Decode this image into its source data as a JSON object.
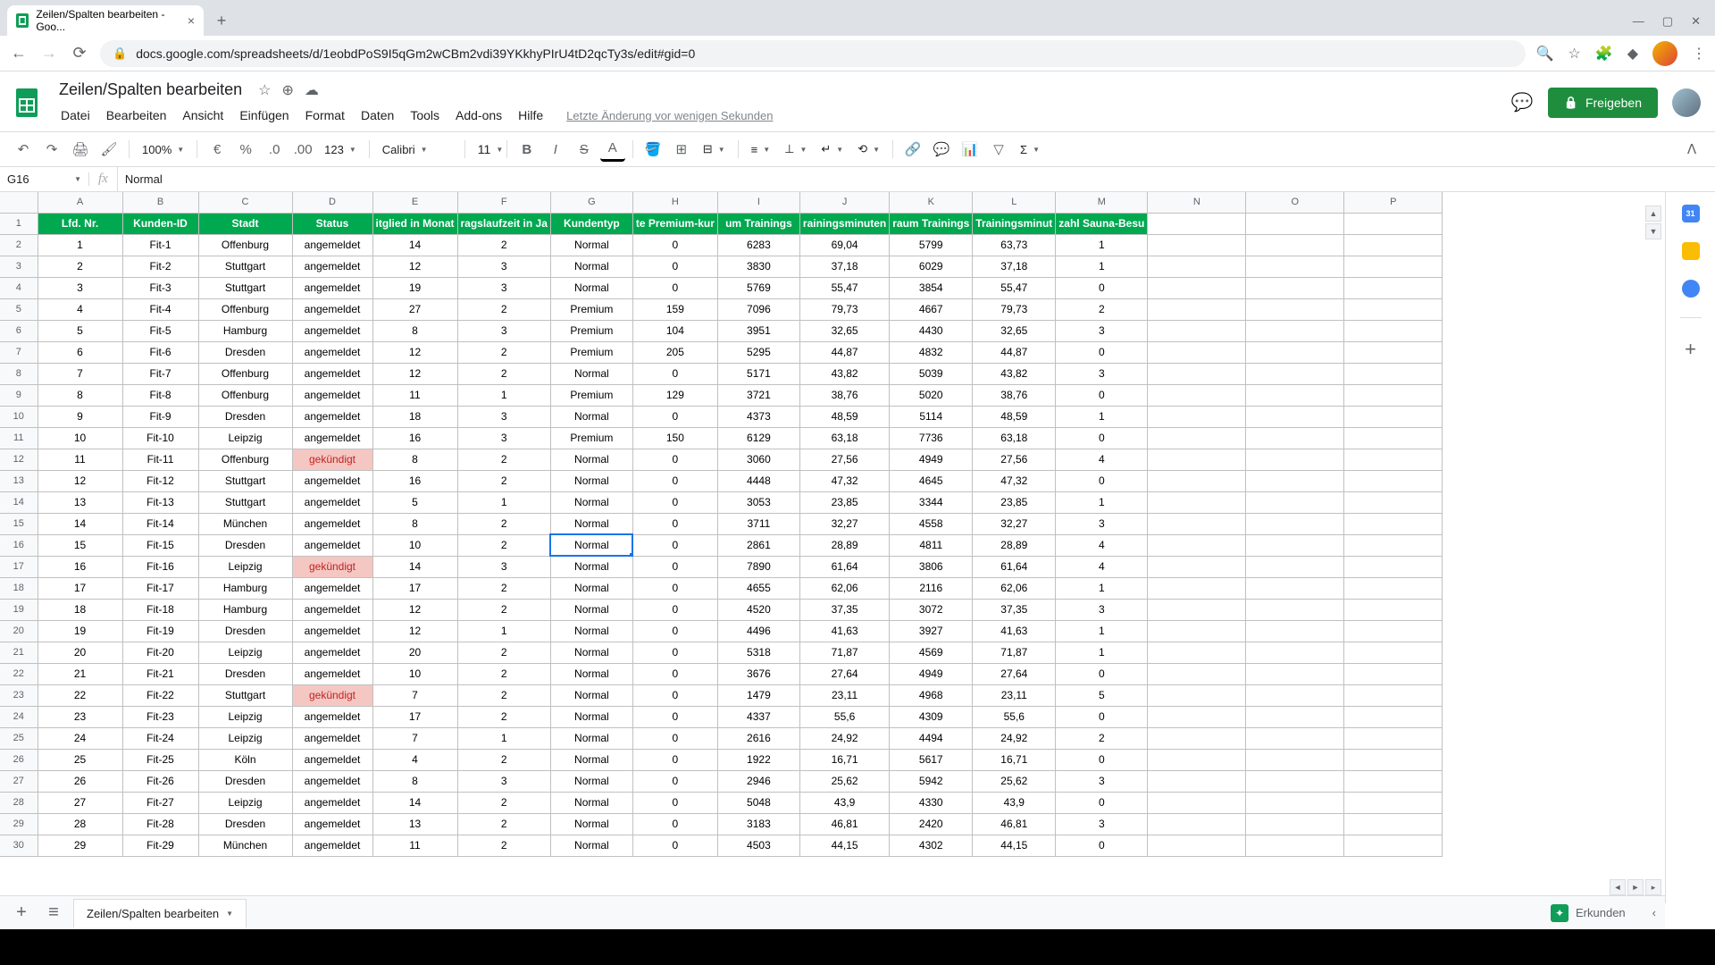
{
  "browser": {
    "tab_title": "Zeilen/Spalten bearbeiten - Goo...",
    "url": "docs.google.com/spreadsheets/d/1eobdPoS9I5qGm2wCBm2vdi39YKkhyPIrU4tD2qcTy3s/edit#gid=0"
  },
  "doc": {
    "title": "Zeilen/Spalten bearbeiten",
    "last_edit": "Letzte Änderung vor wenigen Sekunden"
  },
  "menu": [
    "Datei",
    "Bearbeiten",
    "Ansicht",
    "Einfügen",
    "Format",
    "Daten",
    "Tools",
    "Add-ons",
    "Hilfe"
  ],
  "toolbar": {
    "zoom": "100%",
    "font": "Calibri",
    "font_size": "11",
    "num_fmt": "123"
  },
  "share_label": "Freigeben",
  "name_box": "G16",
  "formula": "Normal",
  "sheet_tab": "Zeilen/Spalten bearbeiten",
  "explore_label": "Erkunden",
  "col_letters": [
    "A",
    "B",
    "C",
    "D",
    "E",
    "F",
    "G",
    "H",
    "I",
    "J",
    "K",
    "L",
    "M",
    "N",
    "O",
    "P"
  ],
  "headers": [
    "Lfd. Nr.",
    "Kunden-ID",
    "Stadt",
    "Status",
    "itglied in Monat",
    "ragslaufzeit in Ja",
    "Kundentyp",
    "te Premium-kur",
    "um Trainings",
    "rainingsminuten",
    "raum Trainings",
    "Trainingsminut",
    "zahl Sauna-Besu"
  ],
  "rows": [
    [
      1,
      "Fit-1",
      "Offenburg",
      "angemeldet",
      14,
      2,
      "Normal",
      0,
      6283,
      "69,04",
      5799,
      "63,73",
      1
    ],
    [
      2,
      "Fit-2",
      "Stuttgart",
      "angemeldet",
      12,
      3,
      "Normal",
      0,
      3830,
      "37,18",
      6029,
      "37,18",
      1
    ],
    [
      3,
      "Fit-3",
      "Stuttgart",
      "angemeldet",
      19,
      3,
      "Normal",
      0,
      5769,
      "55,47",
      3854,
      "55,47",
      0
    ],
    [
      4,
      "Fit-4",
      "Offenburg",
      "angemeldet",
      27,
      2,
      "Premium",
      159,
      7096,
      "79,73",
      4667,
      "79,73",
      2
    ],
    [
      5,
      "Fit-5",
      "Hamburg",
      "angemeldet",
      8,
      3,
      "Premium",
      104,
      3951,
      "32,65",
      4430,
      "32,65",
      3
    ],
    [
      6,
      "Fit-6",
      "Dresden",
      "angemeldet",
      12,
      2,
      "Premium",
      205,
      5295,
      "44,87",
      4832,
      "44,87",
      0
    ],
    [
      7,
      "Fit-7",
      "Offenburg",
      "angemeldet",
      12,
      2,
      "Normal",
      0,
      5171,
      "43,82",
      5039,
      "43,82",
      3
    ],
    [
      8,
      "Fit-8",
      "Offenburg",
      "angemeldet",
      11,
      1,
      "Premium",
      129,
      3721,
      "38,76",
      5020,
      "38,76",
      0
    ],
    [
      9,
      "Fit-9",
      "Dresden",
      "angemeldet",
      18,
      3,
      "Normal",
      0,
      4373,
      "48,59",
      5114,
      "48,59",
      1
    ],
    [
      10,
      "Fit-10",
      "Leipzig",
      "angemeldet",
      16,
      3,
      "Premium",
      150,
      6129,
      "63,18",
      7736,
      "63,18",
      0
    ],
    [
      11,
      "Fit-11",
      "Offenburg",
      "gekündigt",
      8,
      2,
      "Normal",
      0,
      3060,
      "27,56",
      4949,
      "27,56",
      4
    ],
    [
      12,
      "Fit-12",
      "Stuttgart",
      "angemeldet",
      16,
      2,
      "Normal",
      0,
      4448,
      "47,32",
      4645,
      "47,32",
      0
    ],
    [
      13,
      "Fit-13",
      "Stuttgart",
      "angemeldet",
      5,
      1,
      "Normal",
      0,
      3053,
      "23,85",
      3344,
      "23,85",
      1
    ],
    [
      14,
      "Fit-14",
      "München",
      "angemeldet",
      8,
      2,
      "Normal",
      0,
      3711,
      "32,27",
      4558,
      "32,27",
      3
    ],
    [
      15,
      "Fit-15",
      "Dresden",
      "angemeldet",
      10,
      2,
      "Normal",
      0,
      2861,
      "28,89",
      4811,
      "28,89",
      4
    ],
    [
      16,
      "Fit-16",
      "Leipzig",
      "gekündigt",
      14,
      3,
      "Normal",
      0,
      7890,
      "61,64",
      3806,
      "61,64",
      4
    ],
    [
      17,
      "Fit-17",
      "Hamburg",
      "angemeldet",
      17,
      2,
      "Normal",
      0,
      4655,
      "62,06",
      2116,
      "62,06",
      1
    ],
    [
      18,
      "Fit-18",
      "Hamburg",
      "angemeldet",
      12,
      2,
      "Normal",
      0,
      4520,
      "37,35",
      3072,
      "37,35",
      3
    ],
    [
      19,
      "Fit-19",
      "Dresden",
      "angemeldet",
      12,
      1,
      "Normal",
      0,
      4496,
      "41,63",
      3927,
      "41,63",
      1
    ],
    [
      20,
      "Fit-20",
      "Leipzig",
      "angemeldet",
      20,
      2,
      "Normal",
      0,
      5318,
      "71,87",
      4569,
      "71,87",
      1
    ],
    [
      21,
      "Fit-21",
      "Dresden",
      "angemeldet",
      10,
      2,
      "Normal",
      0,
      3676,
      "27,64",
      4949,
      "27,64",
      0
    ],
    [
      22,
      "Fit-22",
      "Stuttgart",
      "gekündigt",
      7,
      2,
      "Normal",
      0,
      1479,
      "23,11",
      4968,
      "23,11",
      5
    ],
    [
      23,
      "Fit-23",
      "Leipzig",
      "angemeldet",
      17,
      2,
      "Normal",
      0,
      4337,
      "55,6",
      4309,
      "55,6",
      0
    ],
    [
      24,
      "Fit-24",
      "Leipzig",
      "angemeldet",
      7,
      1,
      "Normal",
      0,
      2616,
      "24,92",
      4494,
      "24,92",
      2
    ],
    [
      25,
      "Fit-25",
      "Köln",
      "angemeldet",
      4,
      2,
      "Normal",
      0,
      1922,
      "16,71",
      5617,
      "16,71",
      0
    ],
    [
      26,
      "Fit-26",
      "Dresden",
      "angemeldet",
      8,
      3,
      "Normal",
      0,
      2946,
      "25,62",
      5942,
      "25,62",
      3
    ],
    [
      27,
      "Fit-27",
      "Leipzig",
      "angemeldet",
      14,
      2,
      "Normal",
      0,
      5048,
      "43,9",
      4330,
      "43,9",
      0
    ],
    [
      28,
      "Fit-28",
      "Dresden",
      "angemeldet",
      13,
      2,
      "Normal",
      0,
      3183,
      "46,81",
      2420,
      "46,81",
      3
    ],
    [
      29,
      "Fit-29",
      "München",
      "angemeldet",
      11,
      2,
      "Normal",
      0,
      4503,
      "44,15",
      4302,
      "44,15",
      0
    ]
  ],
  "selected_cell": {
    "row": 15,
    "col": 6
  }
}
